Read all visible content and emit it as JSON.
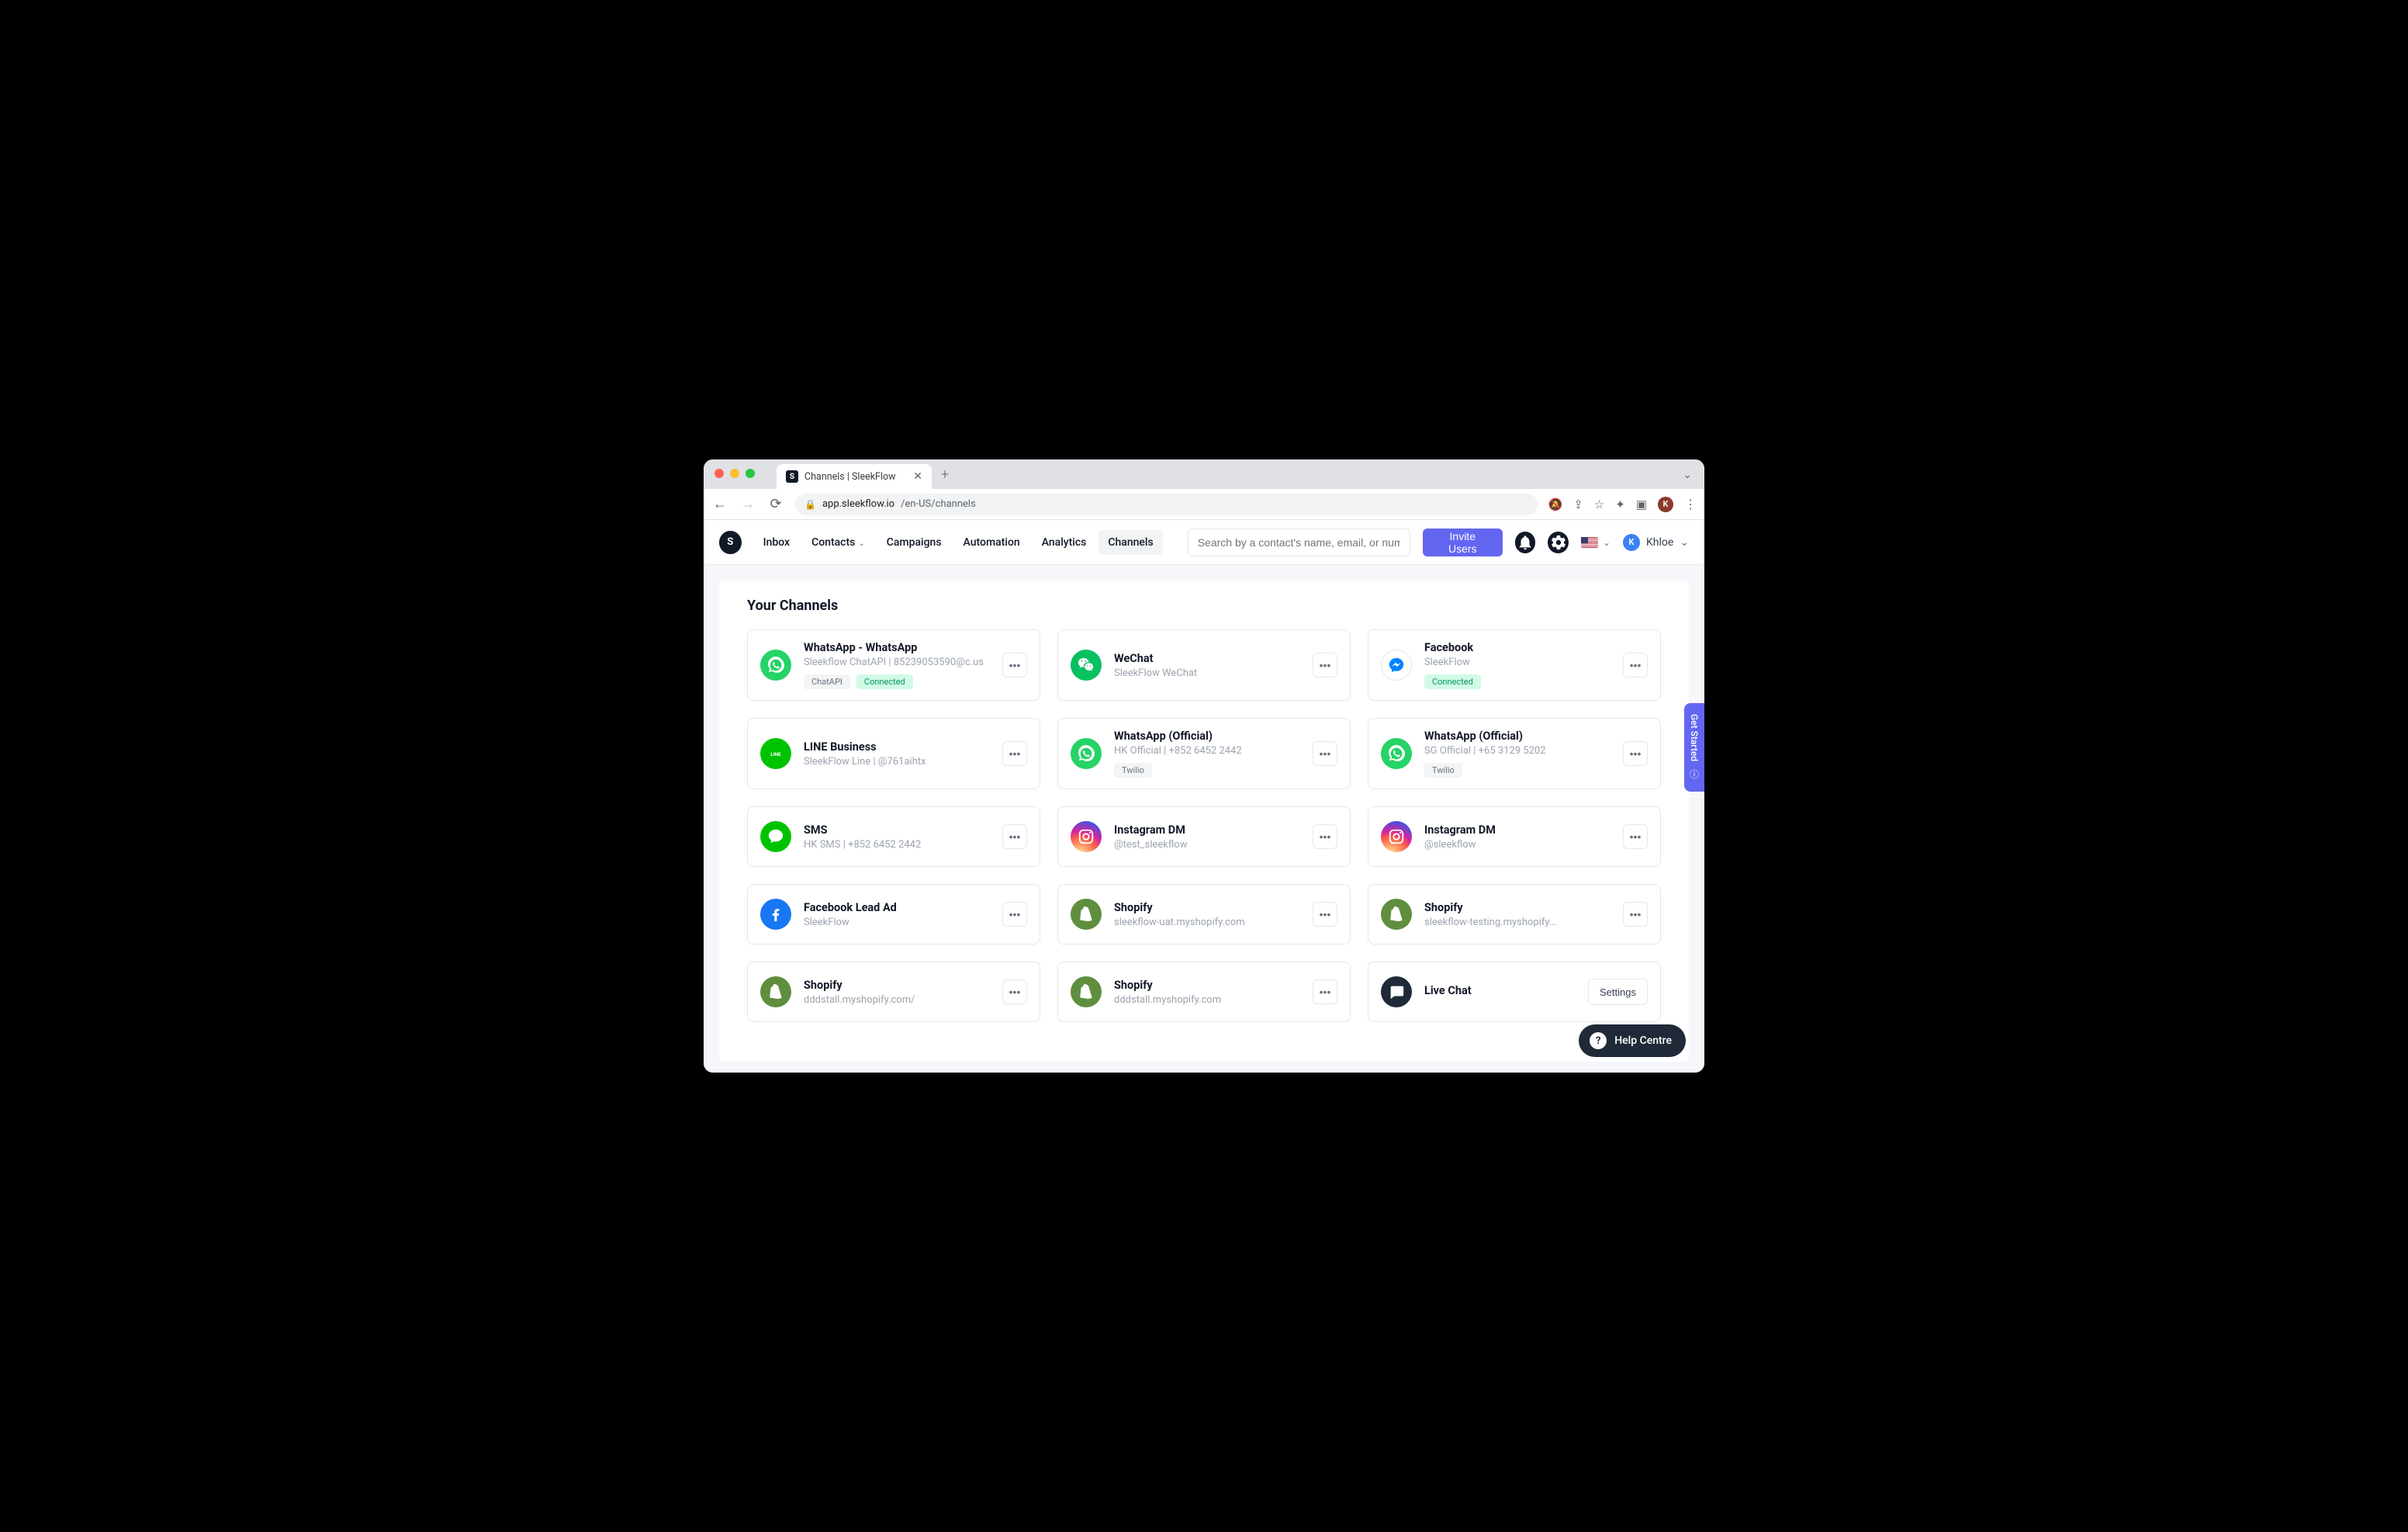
{
  "browser": {
    "tab_title": "Channels | SleekFlow",
    "url_host": "app.sleekflow.io",
    "url_path": "/en-US/channels",
    "profile_initial": "K"
  },
  "nav": {
    "items": [
      "Inbox",
      "Contacts",
      "Campaigns",
      "Automation",
      "Analytics",
      "Channels"
    ],
    "active": "Channels",
    "search_placeholder": "Search by a contact's name, email, or number",
    "invite_label": "Invite Users",
    "user_name": "Khloe",
    "user_initial": "K"
  },
  "page": {
    "title": "Your Channels",
    "get_started": "Get Started",
    "help_label": "Help Centre",
    "settings_label": "Settings"
  },
  "channels": [
    {
      "icon": "whatsapp",
      "title": "WhatsApp - WhatsApp",
      "sub": "Sleekflow ChatAPI | 85239053590@c.us",
      "tags": [
        {
          "t": "ChatAPI"
        },
        {
          "t": "Connected",
          "green": true
        }
      ],
      "action": "more"
    },
    {
      "icon": "wechat",
      "title": "WeChat",
      "sub": "SleekFlow WeChat",
      "tags": [],
      "action": "more"
    },
    {
      "icon": "messenger",
      "title": "Facebook",
      "sub": "SleekFlow",
      "tags": [
        {
          "t": "Connected",
          "green": true
        }
      ],
      "action": "more"
    },
    {
      "icon": "line",
      "title": "LINE Business",
      "sub": "SleekFlow Line | @761aihtx",
      "tags": [],
      "action": "more"
    },
    {
      "icon": "whatsapp",
      "title": "WhatsApp (Official)",
      "sub": "HK Official | +852 6452 2442",
      "tags": [
        {
          "t": "Twilio"
        }
      ],
      "action": "more"
    },
    {
      "icon": "whatsapp",
      "title": "WhatsApp (Official)",
      "sub": "SG Official | +65 3129 5202",
      "tags": [
        {
          "t": "Twilio"
        }
      ],
      "action": "more"
    },
    {
      "icon": "sms",
      "title": "SMS",
      "sub": "HK SMS | +852 6452 2442",
      "tags": [],
      "action": "more"
    },
    {
      "icon": "insta",
      "title": "Instagram DM",
      "sub": "@test_sleekflow",
      "tags": [],
      "action": "more"
    },
    {
      "icon": "insta",
      "title": "Instagram DM",
      "sub": "@sleekflow",
      "tags": [],
      "action": "more"
    },
    {
      "icon": "fb",
      "title": "Facebook Lead Ad",
      "sub": "SleekFlow",
      "tags": [],
      "action": "more"
    },
    {
      "icon": "shopify",
      "title": "Shopify",
      "sub": "sleekflow-uat.myshopify.com",
      "tags": [],
      "action": "more"
    },
    {
      "icon": "shopify",
      "title": "Shopify",
      "sub": "sleekflow-testing.myshopify...",
      "tags": [],
      "action": "more"
    },
    {
      "icon": "shopify",
      "title": "Shopify",
      "sub": "dddstall.myshopify.com/",
      "tags": [],
      "action": "more"
    },
    {
      "icon": "shopify",
      "title": "Shopify",
      "sub": "dddstall.myshopify.com",
      "tags": [],
      "action": "more"
    },
    {
      "icon": "livechat",
      "title": "Live Chat",
      "sub": "",
      "tags": [],
      "action": "settings"
    }
  ]
}
